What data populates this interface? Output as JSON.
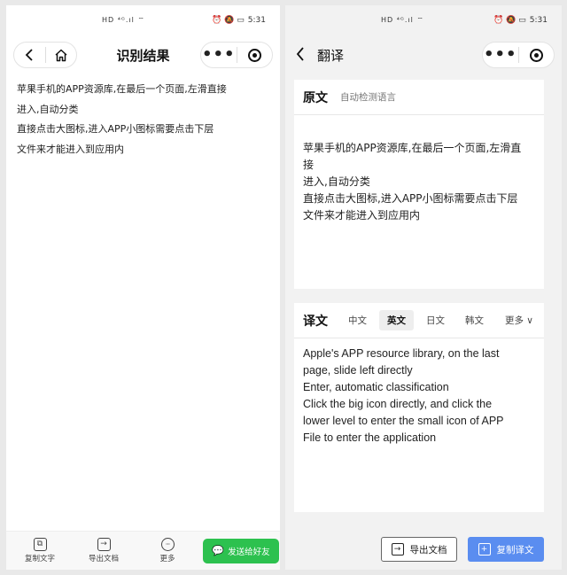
{
  "status": {
    "left_icons": "HD ⁴ᴳ.ıl ⌔",
    "right_icons": "⏰ 🔕 ▭",
    "time": "5:31"
  },
  "left_screen": {
    "title": "识别结果",
    "ocr_lines": [
      "苹果手机的APP资源库,在最后一个页面,左滑直接",
      "进入,自动分类",
      "直接点击大图标,进入APP小图标需要点击下层",
      "文件来才能进入到应用内"
    ],
    "bottom": {
      "copy_text": "复制文字",
      "export_doc": "导出文档",
      "more": "更多",
      "send_friend": "发送给好友"
    }
  },
  "right_screen": {
    "title": "翻译",
    "source": {
      "label": "原文",
      "auto_detect": "自动检测语言",
      "lines": [
        "苹果手机的APP资源库,在最后一个页面,左滑直",
        "接",
        "进入,自动分类",
        "直接点击大图标,进入APP小图标需要点击下层",
        "文件来才能进入到应用内"
      ]
    },
    "target": {
      "label": "译文",
      "tabs": [
        "中文",
        "英文",
        "日文",
        "韩文"
      ],
      "active_tab": "英文",
      "more": "更多 ∨",
      "lines": [
        "Apple's APP resource library, on the last",
        "page, slide left directly",
        "Enter, automatic classification",
        "Click the big icon directly, and click the",
        "lower level to enter the small icon of APP",
        "File to enter the application"
      ]
    },
    "buttons": {
      "export": "导出文档",
      "copy_translation": "复制译文"
    }
  },
  "colors": {
    "send_button": "#2dc14f",
    "copy_translation_button": "#5a8df0"
  }
}
